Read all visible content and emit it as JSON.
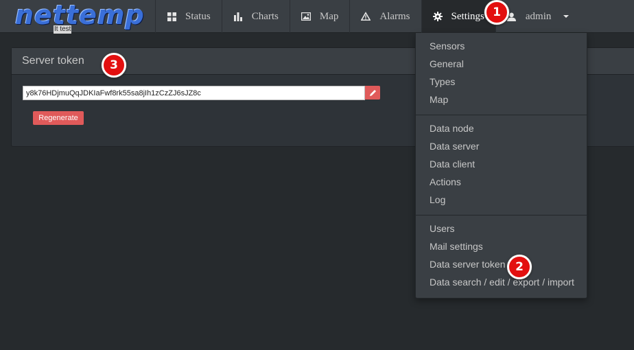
{
  "brand": {
    "logo_text": "nettemp",
    "subtitle": "It test"
  },
  "nav": {
    "status_label": "Status",
    "charts_label": "Charts",
    "map_label": "Map",
    "alarms_label": "Alarms",
    "settings_label": "Settings",
    "user_label": "admin"
  },
  "panel": {
    "title": "Server token",
    "token_value": "y8k76HDjmuQqJDKIaFwf8rk55sa8jIh1zCzZJ6sJZ8c",
    "regenerate_label": "Regenerate"
  },
  "settings_menu": {
    "group1": [
      "Sensors",
      "General",
      "Types",
      "Map"
    ],
    "group2": [
      "Data node",
      "Data server",
      "Data client",
      "Actions",
      "Log"
    ],
    "group3": [
      "Users",
      "Mail settings",
      "Data server token",
      "Data search / edit / export / import"
    ]
  },
  "markers": [
    "1",
    "2",
    "3"
  ],
  "colors": {
    "accent": "#e05a5a",
    "marker": "#e30f0f",
    "navbar": "#3a3f44",
    "background": "#262a2d"
  }
}
